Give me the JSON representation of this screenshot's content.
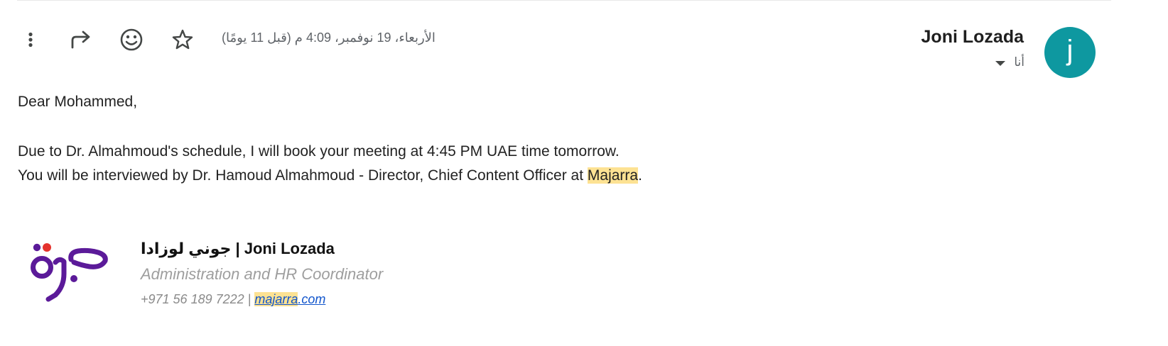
{
  "email": {
    "sender_name": "Joni Lozada",
    "avatar_letter": "j",
    "recipient_label": "أنا",
    "date": "الأربعاء، 19 نوفمبر، 4:09 م (قبل 11 يومًا)",
    "toolbar_icons": [
      "more-vert-icon",
      "forward-icon",
      "emoji-icon",
      "star-icon"
    ],
    "accent_color": "#0e98a0",
    "highlight_color": "#fde293"
  },
  "body": {
    "greeting": "Dear Mohammed,",
    "line1": "Due to Dr. Almahmoud's schedule, I will book your meeting at 4:45 PM UAE time tomorrow.",
    "line2_before": "You will be interviewed by Dr. Hamoud Almahmoud - Director, Chief Content Officer at ",
    "line2_highlight": "Majarra",
    "line2_after": "."
  },
  "signature": {
    "name": "جوني لوزادا | Joni Lozada",
    "title": "Administration and HR Coordinator",
    "phone": "+971 56 189 7222 | ",
    "link_highlight": "majarra",
    "link_rest": ".com",
    "logo_name": "majarra-logo"
  }
}
